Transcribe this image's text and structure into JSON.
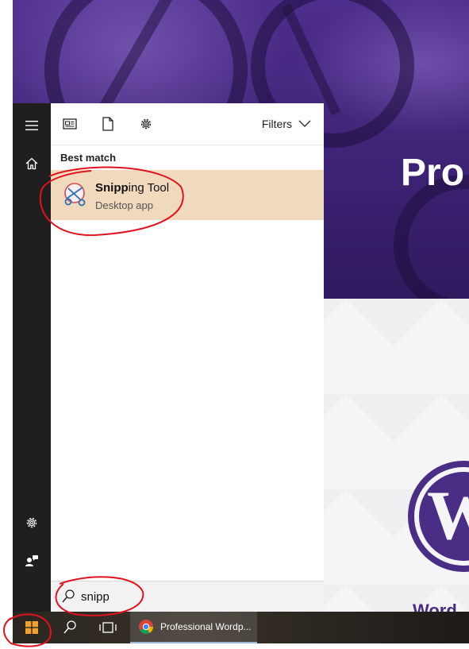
{
  "background_page": {
    "hero_title": "Pro",
    "footer_word": "Word"
  },
  "start_rail": {
    "menu_icon": "hamburger-icon",
    "home_icon": "home-icon",
    "settings_icon": "gear-icon",
    "feedback_icon": "feedback-icon"
  },
  "panel_top": {
    "icons": [
      "documents-icon",
      "file-icon",
      "settings-icon"
    ],
    "filters_label": "Filters"
  },
  "results": {
    "section_label": "Best match",
    "best_match": {
      "title_bold": "Snipp",
      "title_rest": "ing Tool",
      "subtitle": "Desktop app"
    }
  },
  "search": {
    "value": "snipp"
  },
  "taskbar": {
    "chrome_window_label": "Professional Wordp..."
  },
  "colors": {
    "highlight": "#f0d9bc",
    "rail": "#1f1f1f",
    "annotation": "#e0131e",
    "brand_purple": "#4a2d85"
  }
}
